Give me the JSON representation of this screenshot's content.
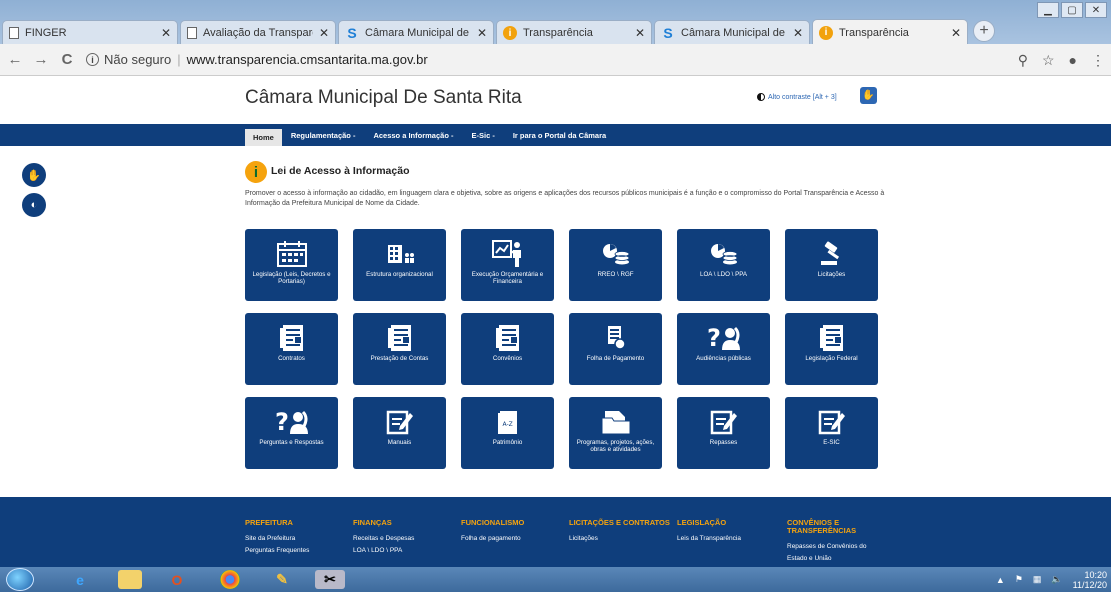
{
  "browser": {
    "tabs": [
      {
        "title": "FINGER",
        "icon": "page-icon",
        "active": false
      },
      {
        "title": "Avaliação da Transparê",
        "icon": "page-icon",
        "active": false
      },
      {
        "title": "Câmara Municipal de S",
        "icon": "s-logo-icon",
        "active": false
      },
      {
        "title": "Transparência",
        "icon": "info-icon",
        "active": false
      },
      {
        "title": "Câmara Municipal de S",
        "icon": "s-logo-icon",
        "active": false
      },
      {
        "title": "Transparência",
        "icon": "info-icon",
        "active": true
      }
    ],
    "address": {
      "security": "Não seguro",
      "url": "www.transparencia.cmsantarita.ma.gov.br"
    }
  },
  "header": {
    "title": "Câmara Municipal De Santa Rita",
    "contrast_label": "Alto contraste [Alt + 3]"
  },
  "nav": {
    "items": [
      "Home",
      "Regulamentação -",
      "Acesso a Informação -",
      "E-Sic -",
      "Ir para o Portal da Câmara"
    ]
  },
  "section": {
    "title": "Lei de Acesso à Informação",
    "intro": "Promover o acesso à informação ao cidadão, em linguagem clara e objetiva, sobre as origens e aplicações dos recursos públicos municipais é a função e o compromisso do Portal Transparência e Acesso à Informação da Prefeitura Municipal de Nome da Cidade."
  },
  "tiles": [
    {
      "label": "Legislação (Leis, Decretos e Portarias)",
      "icon": "calendar-icon"
    },
    {
      "label": "Estrutura organizacional",
      "icon": "org-building-icon"
    },
    {
      "label": "Execução Orçamentária e Financeira",
      "icon": "presentation-icon"
    },
    {
      "label": "RREO \\ RGF",
      "icon": "coins-chart-icon"
    },
    {
      "label": "LOA \\ LDO \\ PPA",
      "icon": "coins-chart-icon"
    },
    {
      "label": "Licitações",
      "icon": "gavel-icon"
    },
    {
      "label": "Contratos",
      "icon": "document-icon"
    },
    {
      "label": "Prestação de Contas",
      "icon": "document-icon"
    },
    {
      "label": "Convênios",
      "icon": "document-icon"
    },
    {
      "label": "Folha de Pagamento",
      "icon": "payslip-icon"
    },
    {
      "label": "Audiências públicas",
      "icon": "question-person-icon"
    },
    {
      "label": "Legislação Federal",
      "icon": "document-icon"
    },
    {
      "label": "Perguntas e Respostas",
      "icon": "question-person-icon"
    },
    {
      "label": "Manuais",
      "icon": "edit-doc-icon"
    },
    {
      "label": "Patrimônio",
      "icon": "az-book-icon"
    },
    {
      "label": "Programas, projetos, ações, obras e atividades",
      "icon": "folder-icon"
    },
    {
      "label": "Repasses",
      "icon": "edit-doc-icon"
    },
    {
      "label": "E-SIC",
      "icon": "edit-doc-icon"
    }
  ],
  "footer": {
    "columns": [
      {
        "heading": "PREFEITURA",
        "links": [
          "Site da Prefeitura",
          "Perguntas Frequentes"
        ]
      },
      {
        "heading": "FINANÇAS",
        "links": [
          "Receitas e Despesas",
          "LOA \\ LDO \\ PPA"
        ]
      },
      {
        "heading": "FUNCIONALISMO",
        "links": [
          "Folha de pagamento"
        ]
      },
      {
        "heading": "LICITAÇÕES E CONTRATOS",
        "links": [
          "Licitações"
        ]
      },
      {
        "heading": "LEGISLAÇÃO",
        "links": [
          "Leis da Transparência"
        ]
      },
      {
        "heading": "CONVÊNIOS E TRANSFERÊNCIAS",
        "links": [
          "Repasses de Convênios do",
          "Estado e União"
        ]
      }
    ]
  },
  "taskbar": {
    "time": "10:20",
    "date": "11/12/20"
  },
  "colors": {
    "brand": "#0f3e7c",
    "accent": "#f5a30e"
  }
}
